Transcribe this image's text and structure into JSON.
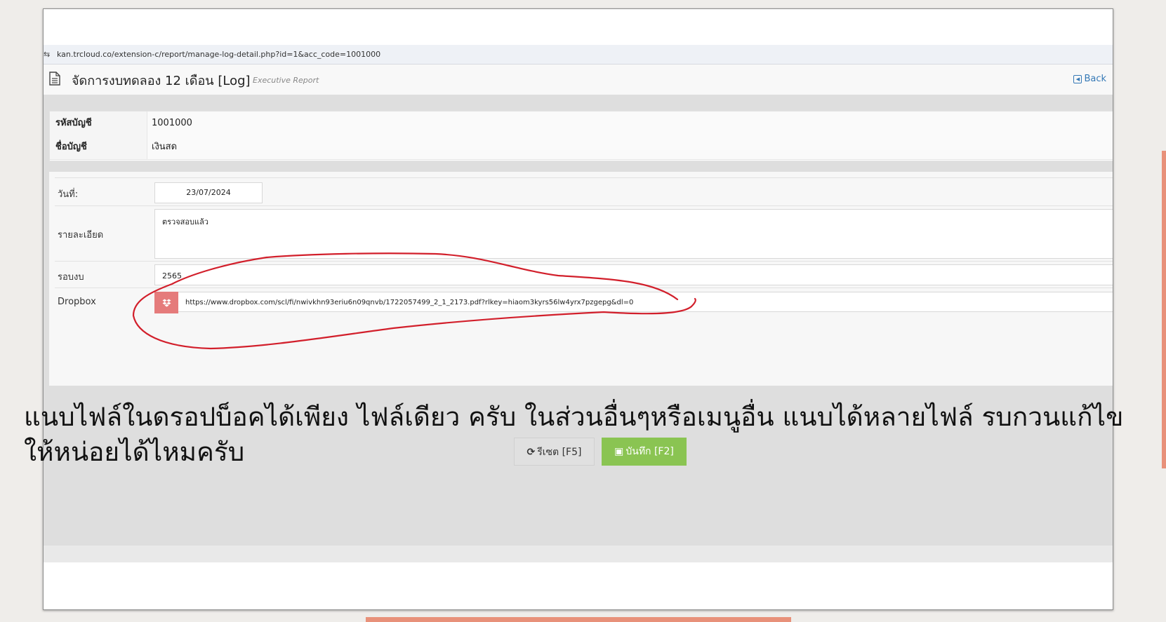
{
  "browser": {
    "url": "kan.trcloud.co/extension-c/report/manage-log-detail.php?id=1&acc_code=1001000",
    "tune_icon": "tune-icon"
  },
  "header": {
    "title": "จัดการงบทดลอง 12 เดือน [Log]",
    "subtitle": "Executive Report",
    "back_label": "Back",
    "doc_icon": "document-icon"
  },
  "account": {
    "code_label": "รหัสบัญชี",
    "code_value": "1001000",
    "name_label": "ชื่อบัญชี",
    "name_value": "เงินสด"
  },
  "form": {
    "date_label": "วันที่:",
    "date_value": "23/07/2024",
    "detail_label": "รายละเอียด",
    "detail_value": "ตรวจสอบแล้ว",
    "period_label": "รอบงบ",
    "period_value": "2565",
    "dropbox_label": "Dropbox",
    "dropbox_icon": "dropbox-icon",
    "dropbox_value": "https://www.dropbox.com/scl/fi/nwivkhn93eriu6n09qnvb/1722057499_2_1_2173.pdf?rlkey=hiaom3kyrs56lw4yrx7pzgepg&dl=0"
  },
  "buttons": {
    "reset_label": "รีเซต [F5]",
    "reset_icon": "refresh-icon",
    "save_label": "บันทึก [F2]",
    "save_icon": "save-icon"
  },
  "annotation": {
    "caption": "แนบไฟล์ในดรอปบ็อคได้เพียง ไฟล์เดียว ครับ ในส่วนอื่นๆหรือเมนูอื่น แนบได้หลายไฟล์ รบกวนแก้ไขให้หน่อยได้ไหมครับ",
    "stroke_color": "#d21f2b"
  },
  "colors": {
    "accent": "#e8917a",
    "save_button": "#8ac452",
    "dropbox_addon": "#e57b7b",
    "link": "#3579b6"
  }
}
